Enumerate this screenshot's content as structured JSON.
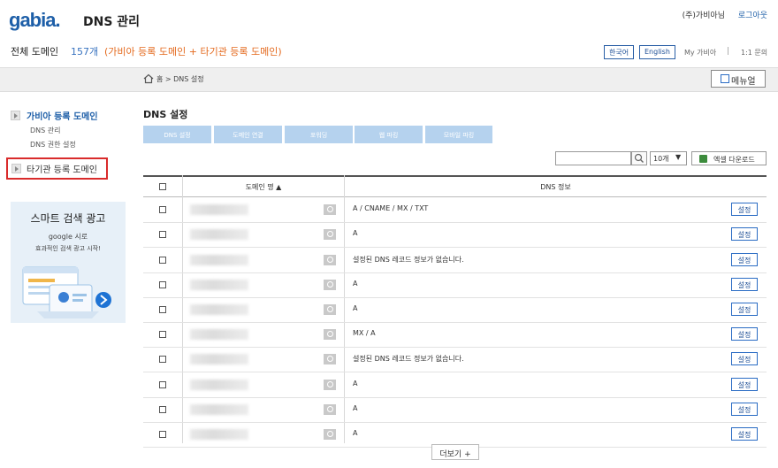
{
  "header": {
    "logo": "gabia.",
    "title": "DNS 관리",
    "user": "(주)가비아님",
    "logout": "로그아웃"
  },
  "summary": {
    "label": "전체 도메인",
    "count": "157개",
    "desc": "(가비아 등록 도메인 + 타기관 등록 도메인)"
  },
  "top_links": {
    "lang_ko": "한국어",
    "lang_en": "English",
    "my_gabia": "My 가비아",
    "separator": "|",
    "qna": "1:1 문의"
  },
  "breadcrumb": "홈 > DNS 설정",
  "manual_label": "메뉴얼",
  "sidebar": {
    "gabia_domains": "가비아 등록 도메인",
    "dns_manage": "DNS 관리",
    "dns_permission": "DNS 권한 설정",
    "other_domains": "타기관 등록 도메인"
  },
  "ad": {
    "title": "스마트 검색 광고",
    "line1": "google 시로",
    "line2": "효과적인 검색 광고 시작!"
  },
  "main": {
    "title": "DNS 설정",
    "tabs": [
      "DNS 설정",
      "도메인 연결",
      "포워딩",
      "웹 파킹",
      "모바일 파킹"
    ],
    "per_page": "10개",
    "excel": "엑셀 다운로드",
    "columns": {
      "domain": "도메인 명 ▲",
      "dns": "DNS 정보"
    },
    "set_label": "설정",
    "more": "더보기 +"
  },
  "rows": [
    {
      "domain": "",
      "dns": "A / CNAME / MX / TXT"
    },
    {
      "domain": "",
      "dns": "A"
    },
    {
      "domain": "",
      "dns": "설정된 DNS 레코드 정보가 없습니다."
    },
    {
      "domain": "",
      "dns": "A"
    },
    {
      "domain": "",
      "dns": "A"
    },
    {
      "domain": "",
      "dns": "MX / A"
    },
    {
      "domain": "",
      "dns": "설정된 DNS 레코드 정보가 없습니다."
    },
    {
      "domain": "",
      "dns": "A"
    },
    {
      "domain": "",
      "dns": "A"
    },
    {
      "domain": "",
      "dns": "A"
    }
  ],
  "colors": {
    "brand": "#1e5fa8",
    "accent_orange": "#e46a1e",
    "tab_bg": "#b5d2ee",
    "highlight_red": "#d92b2b"
  }
}
